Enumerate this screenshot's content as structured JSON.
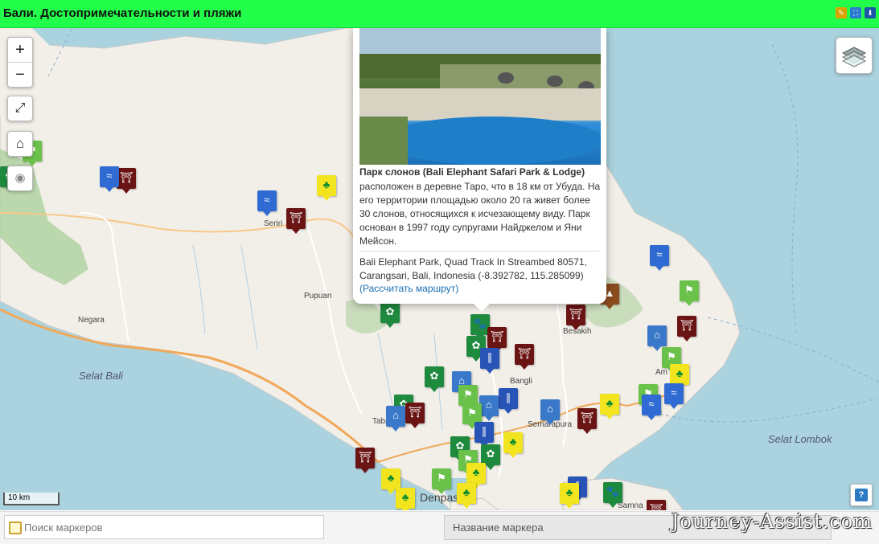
{
  "header": {
    "title": "Бали. Достопримечательности и пляжи"
  },
  "map": {
    "zoom_in": "+",
    "zoom_out": "−",
    "scale_label": "10 km",
    "help_label": "?",
    "place_labels": [
      "Seriri",
      "Pupuan",
      "Negara",
      "Bangli",
      "Besakih",
      "Semarapura",
      "Tabanan",
      "Denpasar",
      "Samna",
      "Am",
      "Ca"
    ],
    "sea_labels": [
      "Selat Bali",
      "Selat Lombok"
    ]
  },
  "popup": {
    "title": "Парк слонов (Bali Elephant Safari Park & Lodge)",
    "description": "расположен в деревне Таро, что в 18 км от Убуда. На его территории площадью около 20 га живет более 30 слонов, относящихся к исчезающему виду. Парк основан в 1997 году супругами Найджелом и Яни Мейсон.",
    "address": "Bali Elephant Park, Quad Track In Streambed 80571, Carangsari, Bali, Indonesia (-8.392782, 115.285099)",
    "route_link": "(Рассчитать маршрут)"
  },
  "bottom": {
    "search_placeholder": "Поиск маркеров",
    "marker_name_label": "Название маркера",
    "watermark": "Journey-Assist.com"
  },
  "colors": {
    "header_bg": "#22ff4a",
    "water": "#aad3df",
    "land": "#f2efe9",
    "forest": "#add19e"
  }
}
